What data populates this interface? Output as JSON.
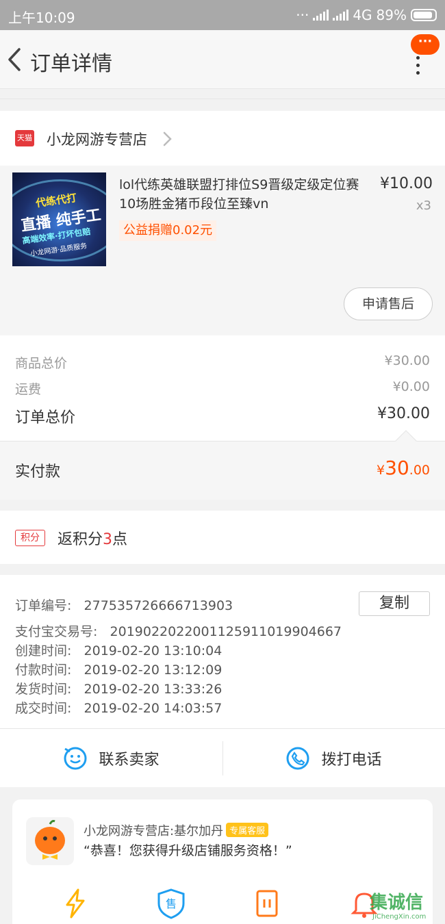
{
  "status_bar": {
    "time": "上午10:09",
    "network": "4G",
    "battery": "89%",
    "battery_level": 0.89
  },
  "nav": {
    "title": "订单详情",
    "message_badge": "···"
  },
  "shop": {
    "platform_tag": "天猫",
    "name": "小龙网游专营店"
  },
  "item": {
    "title": "lol代练英雄联盟打排位S9晋级定级定位赛10场胜金猪币段位至臻vn",
    "price": "¥10.00",
    "quantity": "x3",
    "donation": "公益捐赠0.02元",
    "thumb_text": {
      "line1": "代练代打",
      "line2": "直播 纯手工",
      "line3": "高端效率·打坏包赔",
      "line4": "小龙网游·品质服务"
    },
    "after_sale_button": "申请售后"
  },
  "totals": {
    "goods_label": "商品总价",
    "goods_value": "¥30.00",
    "shipping_label": "运费",
    "shipping_value": "¥0.00",
    "order_label": "订单总价",
    "order_value": "¥30.00",
    "paid_label": "实付款",
    "paid_currency": "¥",
    "paid_integer": "30",
    "paid_decimal": ".00"
  },
  "points": {
    "tag": "积分",
    "prefix": "返积分",
    "number": "3",
    "suffix": "点"
  },
  "order_info": {
    "order_no_label": "订单编号:",
    "order_no": "277535726666713903",
    "copy_button": "复制",
    "alipay_label": "支付宝交易号:",
    "alipay_no": "2019022022001125911019904667",
    "created_label": "创建时间:",
    "created": "2019-02-20 13:10:04",
    "paid_label": "付款时间:",
    "paid": "2019-02-20 13:12:09",
    "shipped_label": "发货时间:",
    "shipped": "2019-02-20 13:33:26",
    "done_label": "成交时间:",
    "done": "2019-02-20 14:03:57"
  },
  "contact": {
    "seller": "联系卖家",
    "phone": "拨打电话"
  },
  "service_card": {
    "name": "小龙网游专营店:基尔加丹",
    "badge": "专属客服",
    "quote": "“恭喜！您获得升级店铺服务资格！”",
    "icons": [
      "lightning-icon",
      "shield-sale-icon",
      "ticket-icon",
      "bell-icon"
    ]
  },
  "watermark": {
    "text": "集诚信",
    "url": "JiChengXin.com"
  },
  "colors": {
    "accent": "#ff5000",
    "tmall_red": "#e4393c",
    "service_blue": "#1e9ef0"
  }
}
